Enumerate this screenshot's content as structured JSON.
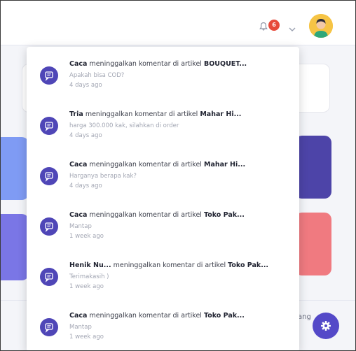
{
  "header": {
    "notification_count": "6"
  },
  "background": {
    "bottom_text_partial": "ang"
  },
  "notifications": [
    {
      "author": "Caca",
      "action": " meninggalkan komentar di artikel ",
      "article": "BOUQUET...",
      "comment": "Apakah bisa COD?",
      "time": "4 days ago"
    },
    {
      "author": "Tria",
      "action": " meninggalkan komentar di artikel ",
      "article": "Mahar Hi...",
      "comment": "harga 300.000 kak, silahkan di order",
      "time": "4 days ago"
    },
    {
      "author": "Caca",
      "action": " meninggalkan komentar di artikel ",
      "article": "Mahar Hi...",
      "comment": "Harganya berapa kak?",
      "time": "4 days ago"
    },
    {
      "author": "Caca",
      "action": " meninggalkan komentar di artikel ",
      "article": "Toko Pak...",
      "comment": "Mantap",
      "time": "1 week ago"
    },
    {
      "author": "Henik Nu...",
      "action": " meninggalkan komentar di artikel ",
      "article": "Toko Pak...",
      "comment": "Terimakasih )",
      "time": "1 week ago"
    },
    {
      "author": "Caca",
      "action": " meninggalkan komentar di artikel ",
      "article": "Toko Pak...",
      "comment": "Mantap",
      "time": "1 week ago"
    }
  ],
  "colors": {
    "accent": "#4f46b7",
    "badge": "#e74a3b"
  }
}
